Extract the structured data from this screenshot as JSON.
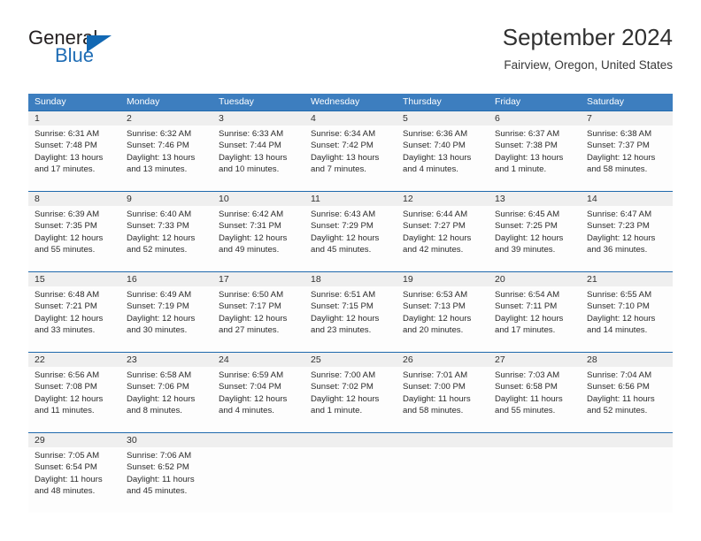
{
  "brand": {
    "name_part1": "General",
    "name_part2": "Blue",
    "logo_icon": "triangle-flag-icon"
  },
  "header": {
    "month_title": "September 2024",
    "location": "Fairview, Oregon, United States"
  },
  "colors": {
    "header_blue": "#3d7ebf",
    "divider_blue": "#1f69ad",
    "daynum_band": "#efefef",
    "brand_blue": "#1268b3",
    "text": "#2b2b2b"
  },
  "weekday_headers": [
    "Sunday",
    "Monday",
    "Tuesday",
    "Wednesday",
    "Thursday",
    "Friday",
    "Saturday"
  ],
  "weeks": [
    {
      "days": [
        {
          "num": "1",
          "l1": "Sunrise: 6:31 AM",
          "l2": "Sunset: 7:48 PM",
          "l3": "Daylight: 13 hours",
          "l4": "and 17 minutes."
        },
        {
          "num": "2",
          "l1": "Sunrise: 6:32 AM",
          "l2": "Sunset: 7:46 PM",
          "l3": "Daylight: 13 hours",
          "l4": "and 13 minutes."
        },
        {
          "num": "3",
          "l1": "Sunrise: 6:33 AM",
          "l2": "Sunset: 7:44 PM",
          "l3": "Daylight: 13 hours",
          "l4": "and 10 minutes."
        },
        {
          "num": "4",
          "l1": "Sunrise: 6:34 AM",
          "l2": "Sunset: 7:42 PM",
          "l3": "Daylight: 13 hours",
          "l4": "and 7 minutes."
        },
        {
          "num": "5",
          "l1": "Sunrise: 6:36 AM",
          "l2": "Sunset: 7:40 PM",
          "l3": "Daylight: 13 hours",
          "l4": "and 4 minutes."
        },
        {
          "num": "6",
          "l1": "Sunrise: 6:37 AM",
          "l2": "Sunset: 7:38 PM",
          "l3": "Daylight: 13 hours",
          "l4": "and 1 minute."
        },
        {
          "num": "7",
          "l1": "Sunrise: 6:38 AM",
          "l2": "Sunset: 7:37 PM",
          "l3": "Daylight: 12 hours",
          "l4": "and 58 minutes."
        }
      ]
    },
    {
      "days": [
        {
          "num": "8",
          "l1": "Sunrise: 6:39 AM",
          "l2": "Sunset: 7:35 PM",
          "l3": "Daylight: 12 hours",
          "l4": "and 55 minutes."
        },
        {
          "num": "9",
          "l1": "Sunrise: 6:40 AM",
          "l2": "Sunset: 7:33 PM",
          "l3": "Daylight: 12 hours",
          "l4": "and 52 minutes."
        },
        {
          "num": "10",
          "l1": "Sunrise: 6:42 AM",
          "l2": "Sunset: 7:31 PM",
          "l3": "Daylight: 12 hours",
          "l4": "and 49 minutes."
        },
        {
          "num": "11",
          "l1": "Sunrise: 6:43 AM",
          "l2": "Sunset: 7:29 PM",
          "l3": "Daylight: 12 hours",
          "l4": "and 45 minutes."
        },
        {
          "num": "12",
          "l1": "Sunrise: 6:44 AM",
          "l2": "Sunset: 7:27 PM",
          "l3": "Daylight: 12 hours",
          "l4": "and 42 minutes."
        },
        {
          "num": "13",
          "l1": "Sunrise: 6:45 AM",
          "l2": "Sunset: 7:25 PM",
          "l3": "Daylight: 12 hours",
          "l4": "and 39 minutes."
        },
        {
          "num": "14",
          "l1": "Sunrise: 6:47 AM",
          "l2": "Sunset: 7:23 PM",
          "l3": "Daylight: 12 hours",
          "l4": "and 36 minutes."
        }
      ]
    },
    {
      "days": [
        {
          "num": "15",
          "l1": "Sunrise: 6:48 AM",
          "l2": "Sunset: 7:21 PM",
          "l3": "Daylight: 12 hours",
          "l4": "and 33 minutes."
        },
        {
          "num": "16",
          "l1": "Sunrise: 6:49 AM",
          "l2": "Sunset: 7:19 PM",
          "l3": "Daylight: 12 hours",
          "l4": "and 30 minutes."
        },
        {
          "num": "17",
          "l1": "Sunrise: 6:50 AM",
          "l2": "Sunset: 7:17 PM",
          "l3": "Daylight: 12 hours",
          "l4": "and 27 minutes."
        },
        {
          "num": "18",
          "l1": "Sunrise: 6:51 AM",
          "l2": "Sunset: 7:15 PM",
          "l3": "Daylight: 12 hours",
          "l4": "and 23 minutes."
        },
        {
          "num": "19",
          "l1": "Sunrise: 6:53 AM",
          "l2": "Sunset: 7:13 PM",
          "l3": "Daylight: 12 hours",
          "l4": "and 20 minutes."
        },
        {
          "num": "20",
          "l1": "Sunrise: 6:54 AM",
          "l2": "Sunset: 7:11 PM",
          "l3": "Daylight: 12 hours",
          "l4": "and 17 minutes."
        },
        {
          "num": "21",
          "l1": "Sunrise: 6:55 AM",
          "l2": "Sunset: 7:10 PM",
          "l3": "Daylight: 12 hours",
          "l4": "and 14 minutes."
        }
      ]
    },
    {
      "days": [
        {
          "num": "22",
          "l1": "Sunrise: 6:56 AM",
          "l2": "Sunset: 7:08 PM",
          "l3": "Daylight: 12 hours",
          "l4": "and 11 minutes."
        },
        {
          "num": "23",
          "l1": "Sunrise: 6:58 AM",
          "l2": "Sunset: 7:06 PM",
          "l3": "Daylight: 12 hours",
          "l4": "and 8 minutes."
        },
        {
          "num": "24",
          "l1": "Sunrise: 6:59 AM",
          "l2": "Sunset: 7:04 PM",
          "l3": "Daylight: 12 hours",
          "l4": "and 4 minutes."
        },
        {
          "num": "25",
          "l1": "Sunrise: 7:00 AM",
          "l2": "Sunset: 7:02 PM",
          "l3": "Daylight: 12 hours",
          "l4": "and 1 minute."
        },
        {
          "num": "26",
          "l1": "Sunrise: 7:01 AM",
          "l2": "Sunset: 7:00 PM",
          "l3": "Daylight: 11 hours",
          "l4": "and 58 minutes."
        },
        {
          "num": "27",
          "l1": "Sunrise: 7:03 AM",
          "l2": "Sunset: 6:58 PM",
          "l3": "Daylight: 11 hours",
          "l4": "and 55 minutes."
        },
        {
          "num": "28",
          "l1": "Sunrise: 7:04 AM",
          "l2": "Sunset: 6:56 PM",
          "l3": "Daylight: 11 hours",
          "l4": "and 52 minutes."
        }
      ]
    },
    {
      "days": [
        {
          "num": "29",
          "l1": "Sunrise: 7:05 AM",
          "l2": "Sunset: 6:54 PM",
          "l3": "Daylight: 11 hours",
          "l4": "and 48 minutes."
        },
        {
          "num": "30",
          "l1": "Sunrise: 7:06 AM",
          "l2": "Sunset: 6:52 PM",
          "l3": "Daylight: 11 hours",
          "l4": "and 45 minutes."
        },
        {
          "num": "",
          "l1": "",
          "l2": "",
          "l3": "",
          "l4": ""
        },
        {
          "num": "",
          "l1": "",
          "l2": "",
          "l3": "",
          "l4": ""
        },
        {
          "num": "",
          "l1": "",
          "l2": "",
          "l3": "",
          "l4": ""
        },
        {
          "num": "",
          "l1": "",
          "l2": "",
          "l3": "",
          "l4": ""
        },
        {
          "num": "",
          "l1": "",
          "l2": "",
          "l3": "",
          "l4": ""
        }
      ]
    }
  ]
}
